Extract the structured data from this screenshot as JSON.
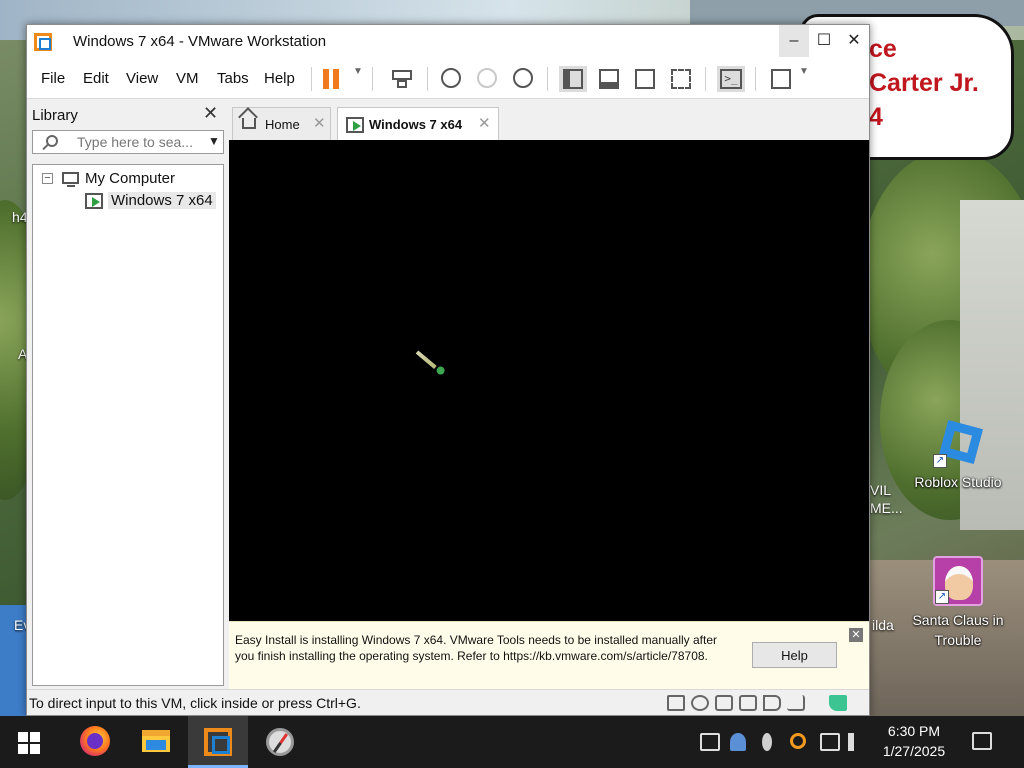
{
  "desktop": {
    "speech_lines": [
      "ce",
      "Carter Jr.",
      "4"
    ],
    "icons": [
      {
        "label": "Roblox Studio"
      },
      {
        "label": "Santa Claus in Trouble"
      }
    ],
    "partial_labels": [
      "VIL",
      "ME...",
      "ilda",
      "h4",
      "A",
      "Ev"
    ]
  },
  "window": {
    "title": "Windows 7 x64 - VMware Workstation",
    "controls": {
      "minimize": "–",
      "maximize": "☐",
      "close": "✕"
    }
  },
  "menu": {
    "items": [
      "File",
      "Edit",
      "View",
      "VM",
      "Tabs",
      "Help"
    ]
  },
  "toolbar": {
    "icons": [
      "pause-icon",
      "send-ctrl-alt-del-icon",
      "snapshot-icon",
      "revert-snapshot-icon",
      "snapshot-manager-icon",
      "library-view-icon",
      "thumbnail-bar-icon",
      "full-screen-icon",
      "unity-icon",
      "console-icon",
      "stretch-guest-icon"
    ],
    "console_glyph": ">_"
  },
  "library": {
    "title": "Library",
    "close": "✕",
    "search_placeholder": "Type here to sea...",
    "tree": {
      "toggle": "−",
      "root": "My Computer",
      "children": [
        "Windows 7 x64"
      ]
    }
  },
  "tabs": [
    {
      "label": "Home",
      "active": false,
      "close": "✕"
    },
    {
      "label": "Windows 7 x64",
      "active": true,
      "close": "✕"
    }
  ],
  "notice": {
    "text": "Easy Install is installing Windows 7 x64. VMware Tools needs to be installed manually after you finish installing the operating system. Refer to https://kb.vmware.com/s/article/78708.",
    "help_label": "Help",
    "close": "✕"
  },
  "status": {
    "text": "To direct input to this VM, click inside or press Ctrl+G.",
    "devices": [
      "hard-disk-icon",
      "cd-dvd-icon",
      "floppy-icon",
      "network-adapter-icon",
      "sound-card-icon",
      "usb-icon",
      "message-log-icon"
    ]
  },
  "taskbar": {
    "apps": [
      "firefox-icon",
      "file-explorer-icon",
      "vmware-workstation-icon",
      "compass-app-icon"
    ],
    "time": "6:30 PM",
    "date": "1/27/2025"
  }
}
